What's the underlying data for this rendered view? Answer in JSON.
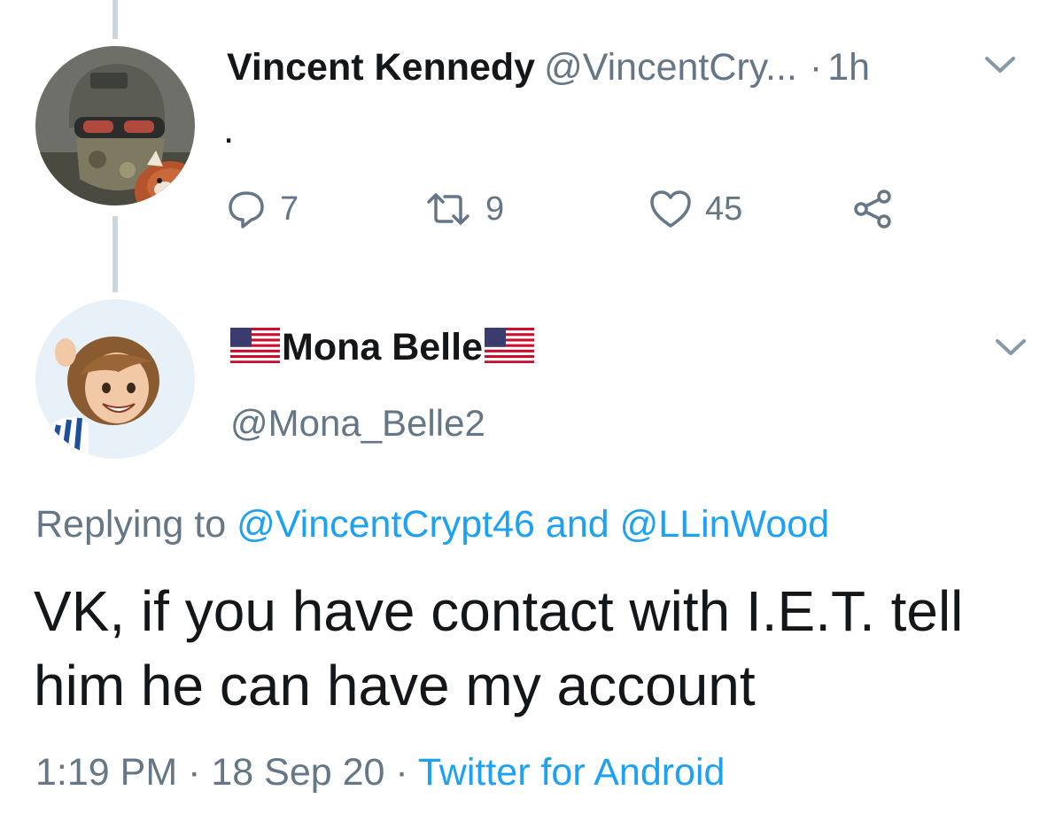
{
  "tweet1": {
    "name": "Vincent Kennedy",
    "handle": "@VincentCry...",
    "separator": "·",
    "time": "1h",
    "text": ".",
    "reply_count": "7",
    "retweet_count": "9",
    "like_count": "45",
    "avatar_icon": "soldier-with-red-panda-avatar"
  },
  "tweet2": {
    "name": "Mona Belle",
    "flag_icon": "us-flag-emoji",
    "handle": "@Mona_Belle2",
    "replying_prefix": "Replying to",
    "reply_mention_1": "@VincentCrypt46",
    "reply_and": "and",
    "reply_mention_2": "@LLinWood",
    "text": "VK, if you have contact with I.E.T. tell him he can have my account",
    "time": "1:19 PM",
    "separator": "·",
    "date": "18 Sep 20",
    "separator2": "·",
    "source": "Twitter for Android",
    "avatar_icon": "memoji-avatar"
  },
  "colors": {
    "text": "#14171a",
    "secondary": "#657786",
    "link": "#1da1f2",
    "thread_line": "#ccd6dd"
  }
}
